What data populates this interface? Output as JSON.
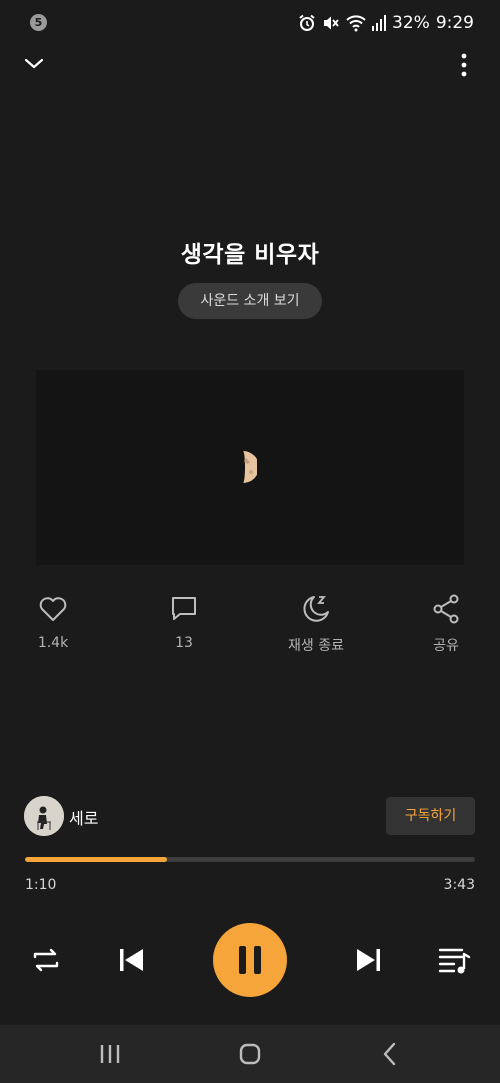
{
  "status_bar": {
    "notification_count": "5",
    "battery": "32%",
    "time": "9:29"
  },
  "track": {
    "title": "생각을 비우자",
    "intro_button": "사운드 소개 보기",
    "artist": "세로",
    "subscribe_button": "구독하기",
    "elapsed": "1:10",
    "duration": "3:43",
    "progress_fraction": 0.315
  },
  "actions": {
    "like_count": "1.4k",
    "comment_count": "13",
    "sleep_label": "재생 종료",
    "share_label": "공유"
  },
  "colors": {
    "accent": "#f6a53b",
    "background": "#1b1b1b"
  },
  "icons": [
    "chevron-down-icon",
    "more-vert-icon",
    "heart-icon",
    "comment-icon",
    "sleep-timer-icon",
    "share-icon",
    "repeat-icon",
    "previous-icon",
    "pause-icon",
    "next-icon",
    "playlist-icon",
    "recents-icon",
    "home-icon",
    "back-icon"
  ]
}
